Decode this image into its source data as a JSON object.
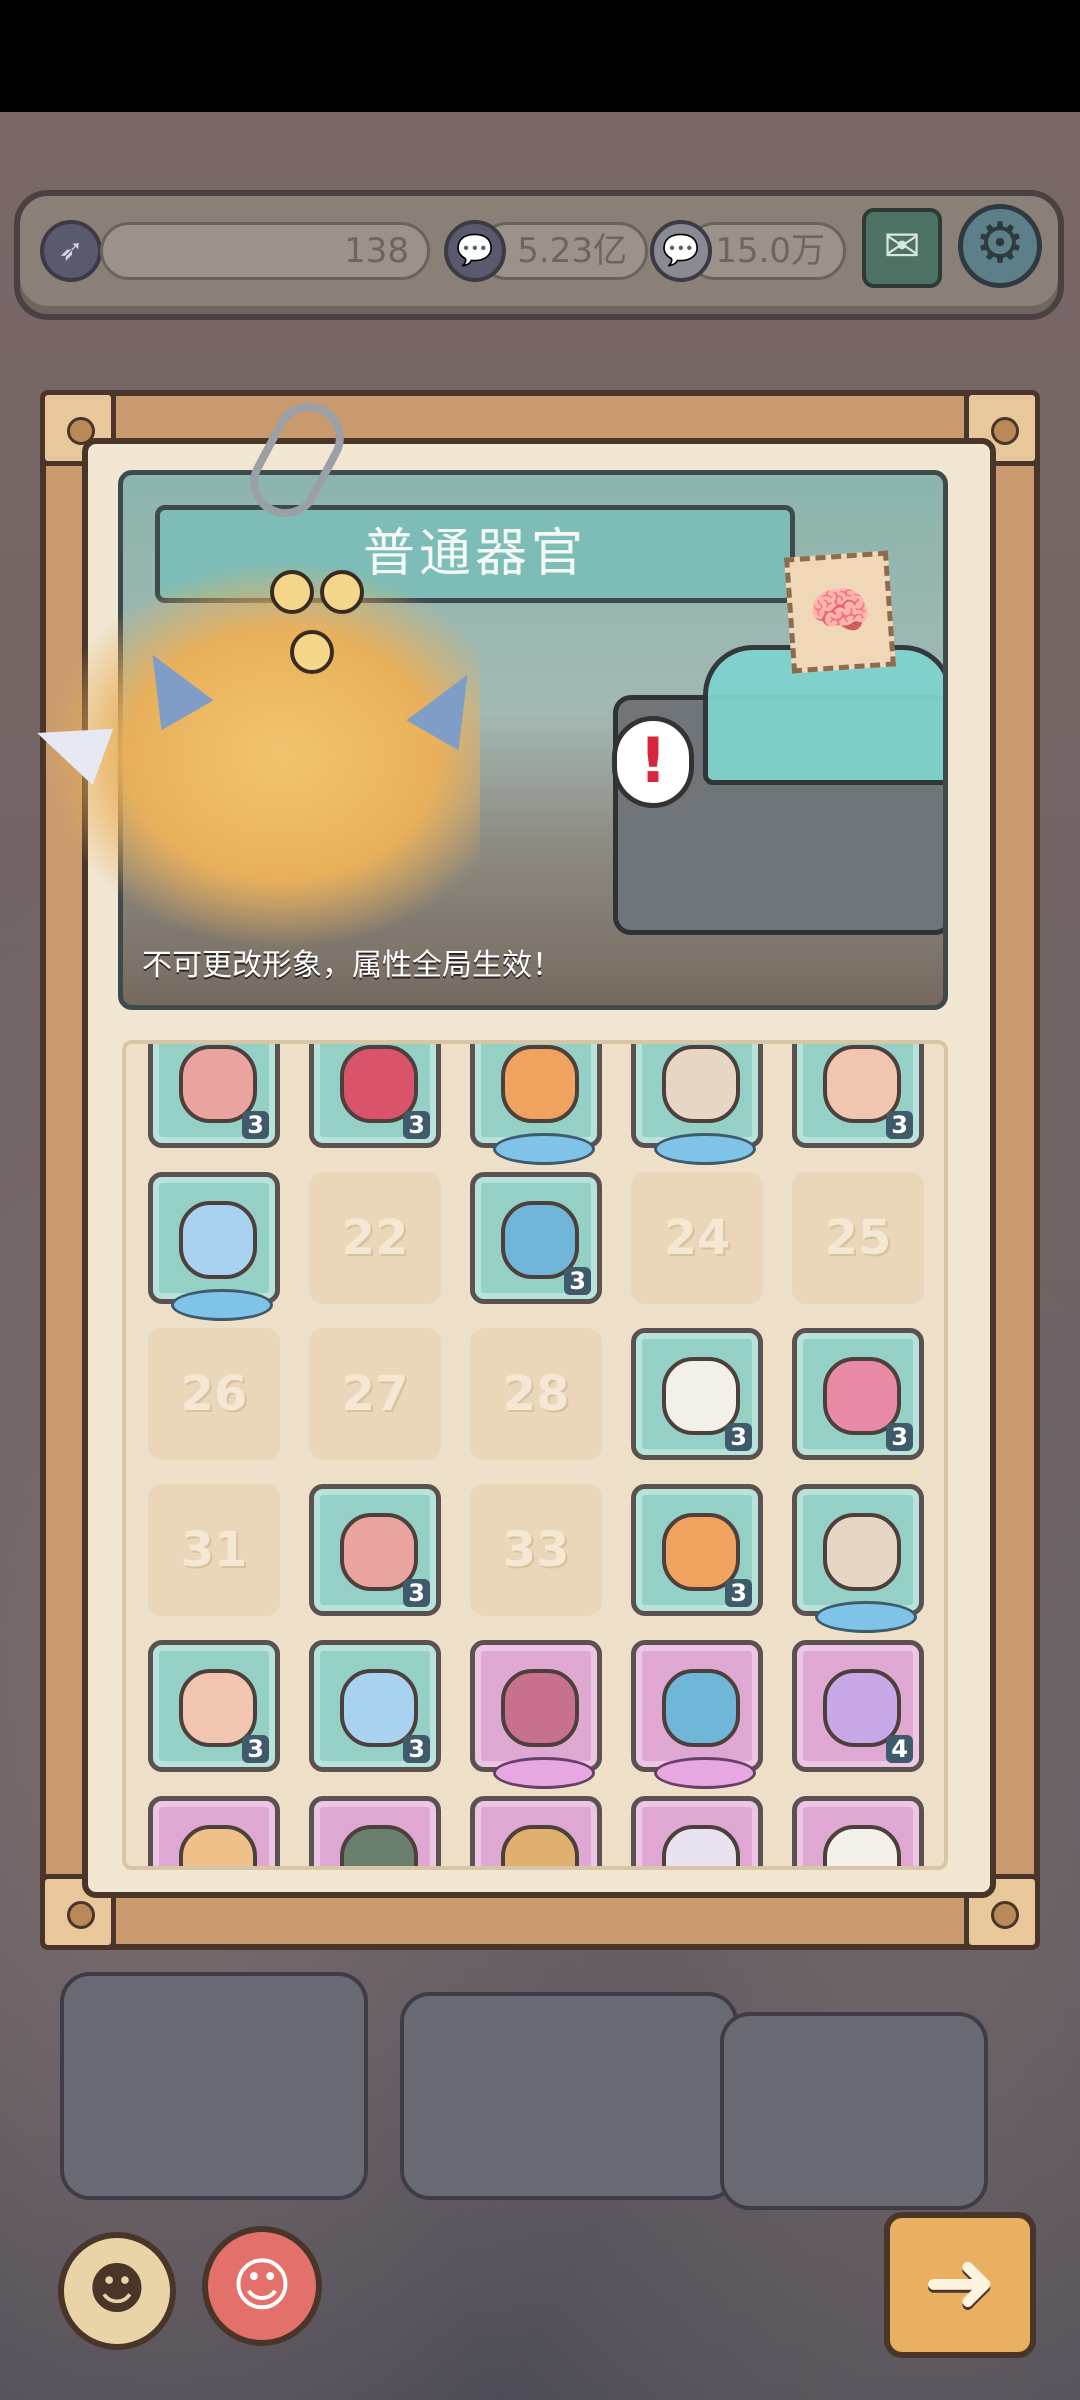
{
  "resources": {
    "energy_value": "138",
    "currency_a_value": "5.23亿",
    "currency_b_value": "15.0万"
  },
  "icons": {
    "energy": "rocket-icon",
    "currency_a": "chat-bubble-icon",
    "currency_b": "chat-bubble-icon",
    "mail": "mail-icon",
    "settings": "gear-icon"
  },
  "panel": {
    "title": "普通器官",
    "caption": "不可更改形象，属性全局生效！"
  },
  "grid": {
    "rows": [
      [
        {
          "state": "filled",
          "count": "3"
        },
        {
          "state": "filled",
          "count": "3"
        },
        {
          "state": "filled",
          "wings": "blue"
        },
        {
          "state": "filled",
          "wings": "blue"
        },
        {
          "state": "filled",
          "count": "3"
        }
      ],
      [
        {
          "state": "filled",
          "wings": "blue"
        },
        {
          "state": "empty",
          "label": "22"
        },
        {
          "state": "filled",
          "count": "3"
        },
        {
          "state": "empty",
          "label": "24"
        },
        {
          "state": "empty",
          "label": "25"
        }
      ],
      [
        {
          "state": "empty",
          "label": "26"
        },
        {
          "state": "empty",
          "label": "27"
        },
        {
          "state": "empty",
          "label": "28"
        },
        {
          "state": "filled",
          "count": "3"
        },
        {
          "state": "filled",
          "count": "3"
        }
      ],
      [
        {
          "state": "empty",
          "label": "31"
        },
        {
          "state": "filled",
          "count": "3"
        },
        {
          "state": "empty",
          "label": "33"
        },
        {
          "state": "filled",
          "count": "3"
        },
        {
          "state": "filled",
          "wings": "blue"
        }
      ],
      [
        {
          "state": "filled",
          "count": "3"
        },
        {
          "state": "filled",
          "count": "3"
        },
        {
          "state": "purple",
          "wings": "pink"
        },
        {
          "state": "purple",
          "wings": "pink"
        },
        {
          "state": "purple",
          "count": "4"
        }
      ],
      [
        {
          "state": "purple"
        },
        {
          "state": "purple"
        },
        {
          "state": "purple"
        },
        {
          "state": "purple"
        },
        {
          "state": "purple"
        }
      ]
    ]
  },
  "colors": {
    "slot_teal": "#94d0c6",
    "slot_purple": "#dea8d2",
    "frame_brown": "#4a352a"
  }
}
